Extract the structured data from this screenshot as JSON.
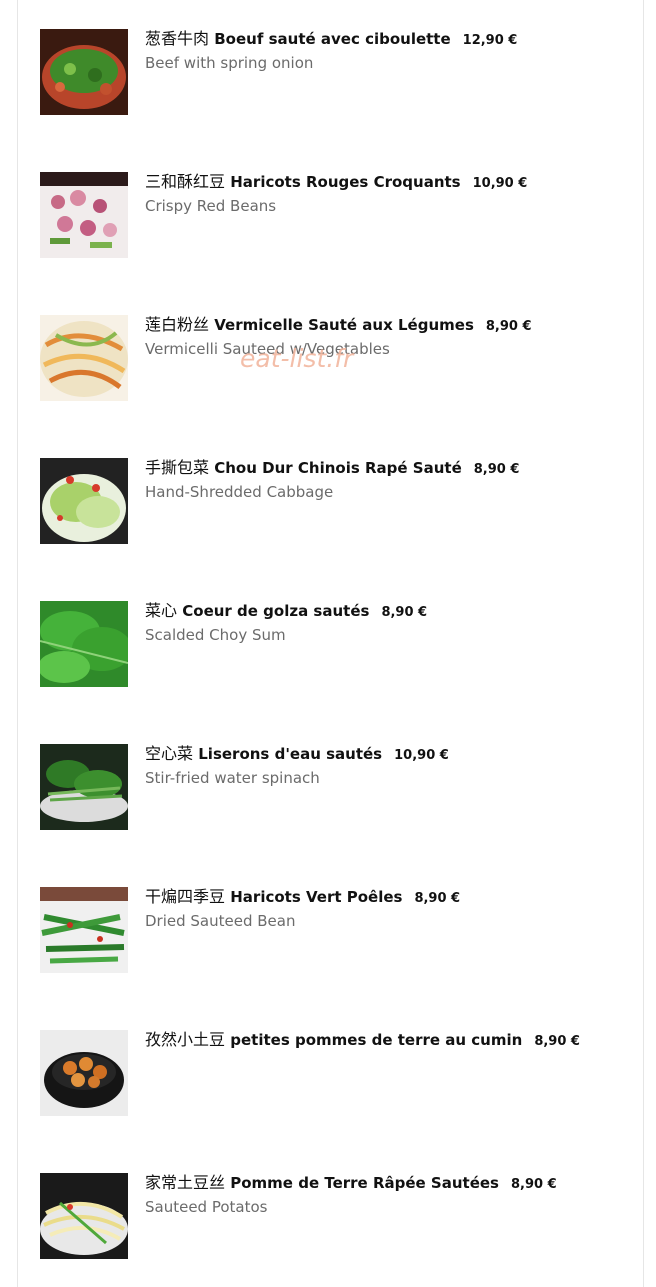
{
  "watermark": "eat-list.fr",
  "items": [
    {
      "zh": "葱香牛肉",
      "fr": "Boeuf sauté avec ciboulette",
      "price": "12,90 €",
      "en": "Beef with spring onion"
    },
    {
      "zh": "三和酥红豆",
      "fr": "Haricots Rouges Croquants",
      "price": "10,90 €",
      "en": "Crispy Red Beans"
    },
    {
      "zh": "莲白粉丝",
      "fr": "Vermicelle Sauté aux Légumes",
      "price": "8,90 €",
      "en": "Vermicelli Sauteed w/Vegetables"
    },
    {
      "zh": "手撕包菜",
      "fr": "Chou Dur Chinois Rapé Sauté",
      "price": "8,90 €",
      "en": "Hand-Shredded Cabbage"
    },
    {
      "zh": "菜心",
      "fr": "Coeur de golza sautés",
      "price": "8,90 €",
      "en": "Scalded Choy Sum"
    },
    {
      "zh": "空心菜",
      "fr": "Liserons d'eau sautés",
      "price": "10,90 €",
      "en": "Stir-fried water spinach"
    },
    {
      "zh": "干煸四季豆",
      "fr": "Haricots Vert Poêles",
      "price": "8,90 €",
      "en": "Dried Sauteed Bean"
    },
    {
      "zh": "孜然小土豆",
      "fr": "petites pommes de terre au cumin",
      "price": "8,90 €",
      "en": ""
    },
    {
      "zh": "家常土豆丝",
      "fr": "Pomme de Terre Râpée Sautées",
      "price": "8,90 €",
      "en": "Sauteed Potatos"
    }
  ]
}
